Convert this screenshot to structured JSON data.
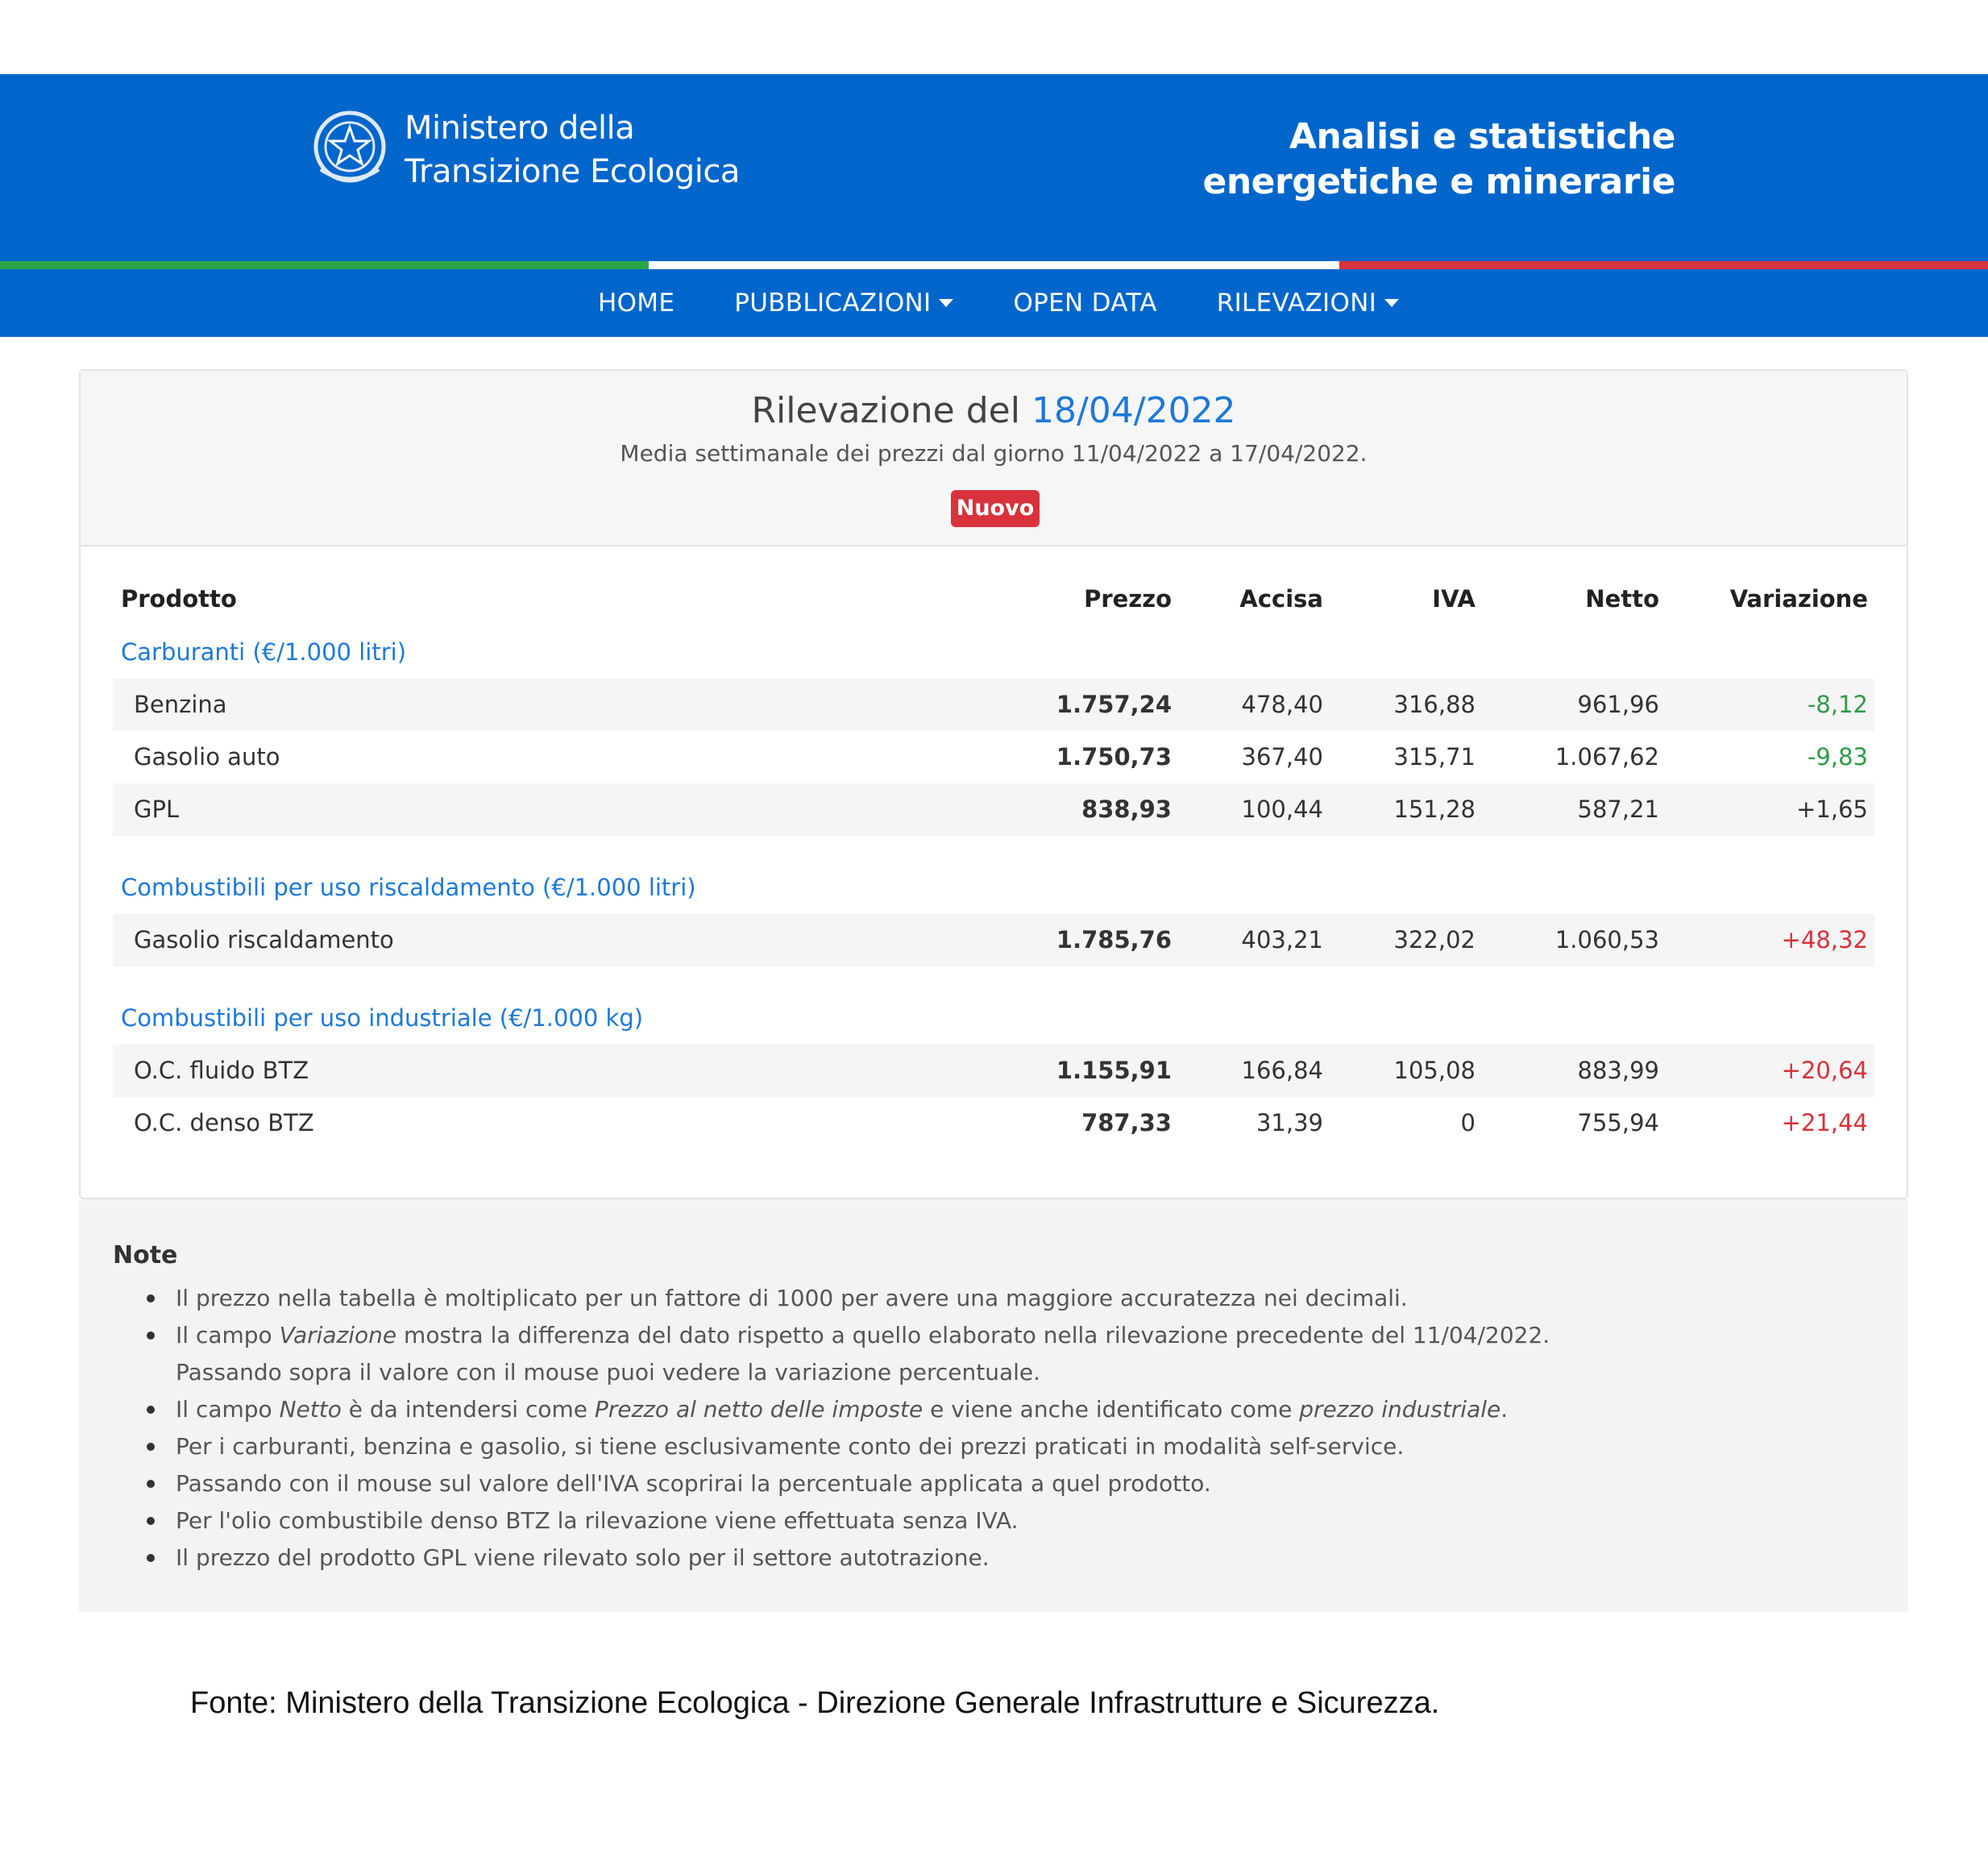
{
  "header": {
    "ministry_line1": "Ministero della",
    "ministry_line2": "Transizione Ecologica",
    "portal_line1": "Analisi e statistiche",
    "portal_line2": "energetiche e minerarie"
  },
  "nav": {
    "home": "HOME",
    "pubblicazioni": "PUBBLICAZIONI",
    "open_data": "OPEN DATA",
    "rilevazioni": "RILEVAZIONI"
  },
  "report": {
    "title_prefix": "Rilevazione del",
    "title_date": "18/04/2022",
    "subtitle": "Media settimanale dei prezzi dal giorno 11/04/2022 a 17/04/2022.",
    "badge": "Nuovo"
  },
  "table": {
    "headers": [
      "Prodotto",
      "Prezzo",
      "Accisa",
      "IVA",
      "Netto",
      "Variazione"
    ],
    "categories": [
      {
        "label": "Carburanti (€/1.000 litri)",
        "rows": [
          {
            "name": "Benzina",
            "prezzo": "1.757,24",
            "accisa": "478,40",
            "iva": "316,88",
            "netto": "961,96",
            "variazione": "-8,12"
          },
          {
            "name": "Gasolio auto",
            "prezzo": "1.750,73",
            "accisa": "367,40",
            "iva": "315,71",
            "netto": "1.067,62",
            "variazione": "-9,83"
          },
          {
            "name": "GPL",
            "prezzo": "838,93",
            "accisa": "100,44",
            "iva": "151,28",
            "netto": "587,21",
            "variazione": "+1,65"
          }
        ]
      },
      {
        "label": "Combustibili per uso riscaldamento (€/1.000 litri)",
        "rows": [
          {
            "name": "Gasolio riscaldamento",
            "prezzo": "1.785,76",
            "accisa": "403,21",
            "iva": "322,02",
            "netto": "1.060,53",
            "variazione": "+48,32"
          }
        ]
      },
      {
        "label": "Combustibili per uso industriale (€/1.000 kg)",
        "rows": [
          {
            "name": "O.C. fluido BTZ",
            "prezzo": "1.155,91",
            "accisa": "166,84",
            "iva": "105,08",
            "netto": "883,99",
            "variazione": "+20,64"
          },
          {
            "name": "O.C. denso BTZ",
            "prezzo": "787,33",
            "accisa": "31,39",
            "iva": "0",
            "netto": "755,94",
            "variazione": "+21,44"
          }
        ]
      }
    ]
  },
  "notes": {
    "title": "Note",
    "n1": "Il prezzo nella tabella è moltiplicato per un fattore di 1000 per avere una maggiore accuratezza nei decimali.",
    "n2_a": "Il campo ",
    "n2_em": "Variazione",
    "n2_b": " mostra la differenza del dato rispetto a quello elaborato nella rilevazione precedente del 11/04/2022.",
    "n2_c": "Passando sopra il valore con il mouse puoi vedere la variazione percentuale.",
    "n3_a": "Il campo ",
    "n3_em1": "Netto",
    "n3_b": " è da intendersi come ",
    "n3_em2": "Prezzo al netto delle imposte",
    "n3_c": " e viene anche identificato come ",
    "n3_em3": "prezzo industriale",
    "n3_d": ".",
    "n4": "Per i carburanti, benzina e gasolio, si tiene esclusivamente conto dei prezzi praticati in modalità self-service.",
    "n5": "Passando con il mouse sul valore dell'IVA scoprirai la percentuale applicata a quel prodotto.",
    "n6": "Per l'olio combustibile denso BTZ la rilevazione viene effettuata senza IVA.",
    "n7": "Il prezzo del prodotto GPL viene rilevato solo per il settore autotrazione."
  },
  "source": "Fonte: Ministero della Transizione Ecologica - Direzione Generale Infrastrutture e Sicurezza.",
  "colors": {
    "brand_blue": "#0066cc",
    "flag_green": "#2ea549",
    "flag_red": "#d8323c",
    "negative_variation": "#2f9b48",
    "positive_variation": "#d8323c"
  }
}
